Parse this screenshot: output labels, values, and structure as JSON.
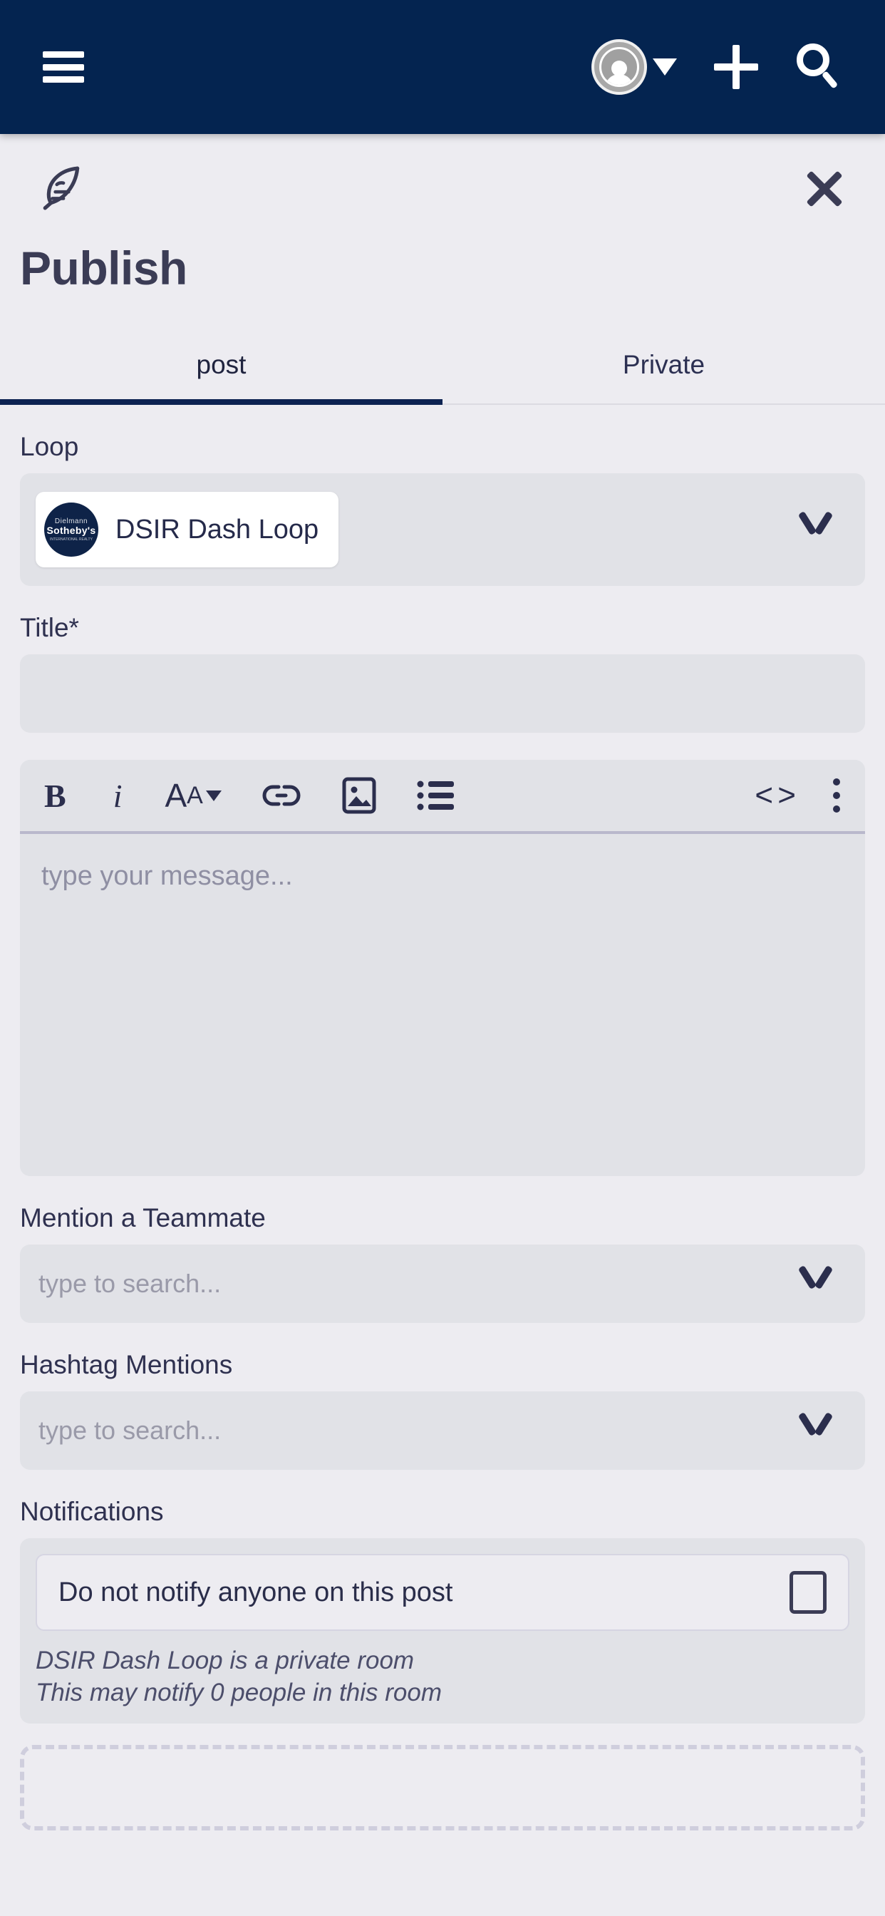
{
  "appbar": {
    "menu_icon": "hamburger-menu-icon",
    "avatar_icon": "user-avatar-icon",
    "avatar_caret": "caret-down-icon",
    "add_icon": "plus-icon",
    "search_icon": "search-icon",
    "background": "#042450"
  },
  "sheet": {
    "brand_icon": "quill-feather-icon",
    "close_icon": "close-icon",
    "title": "Publish"
  },
  "tabs": [
    {
      "label": "post",
      "active": true
    },
    {
      "label": "Private",
      "active": false
    }
  ],
  "form": {
    "loop": {
      "label": "Loop",
      "selected": {
        "name": "DSIR Dash Loop",
        "logo_line1": "Dielmann",
        "logo_line2": "Sotheby's",
        "logo_line3": "INTERNATIONAL REALTY"
      }
    },
    "title": {
      "label": "Title*",
      "value": "",
      "placeholder": ""
    },
    "editor": {
      "placeholder": "type your message...",
      "value": "",
      "toolbar": [
        {
          "name": "bold-icon",
          "glyph": "B"
        },
        {
          "name": "italic-icon",
          "glyph": "i"
        },
        {
          "name": "font-size-icon",
          "glyph": "AA"
        },
        {
          "name": "link-icon",
          "glyph": "link"
        },
        {
          "name": "image-icon",
          "glyph": "image"
        },
        {
          "name": "bullet-list-icon",
          "glyph": "list"
        },
        {
          "name": "code-icon",
          "glyph": "<>"
        },
        {
          "name": "more-options-icon",
          "glyph": "kebab"
        }
      ]
    },
    "mention": {
      "label": "Mention a Teammate",
      "placeholder": "type to search...",
      "value": ""
    },
    "hashtag": {
      "label": "Hashtag Mentions",
      "placeholder": "type to search...",
      "value": ""
    },
    "notifications": {
      "label": "Notifications",
      "option_label": "Do not notify anyone on this post",
      "checked": false,
      "note_line1": "DSIR Dash Loop is a private room",
      "note_line2": "This may notify 0 people in this room"
    }
  },
  "colors": {
    "header": "#042450",
    "page_bg": "#edecf1",
    "field_bg": "#e1e2e7",
    "text": "#2f3150",
    "accent": "#0d2352",
    "placeholder": "#9a9aa9"
  }
}
